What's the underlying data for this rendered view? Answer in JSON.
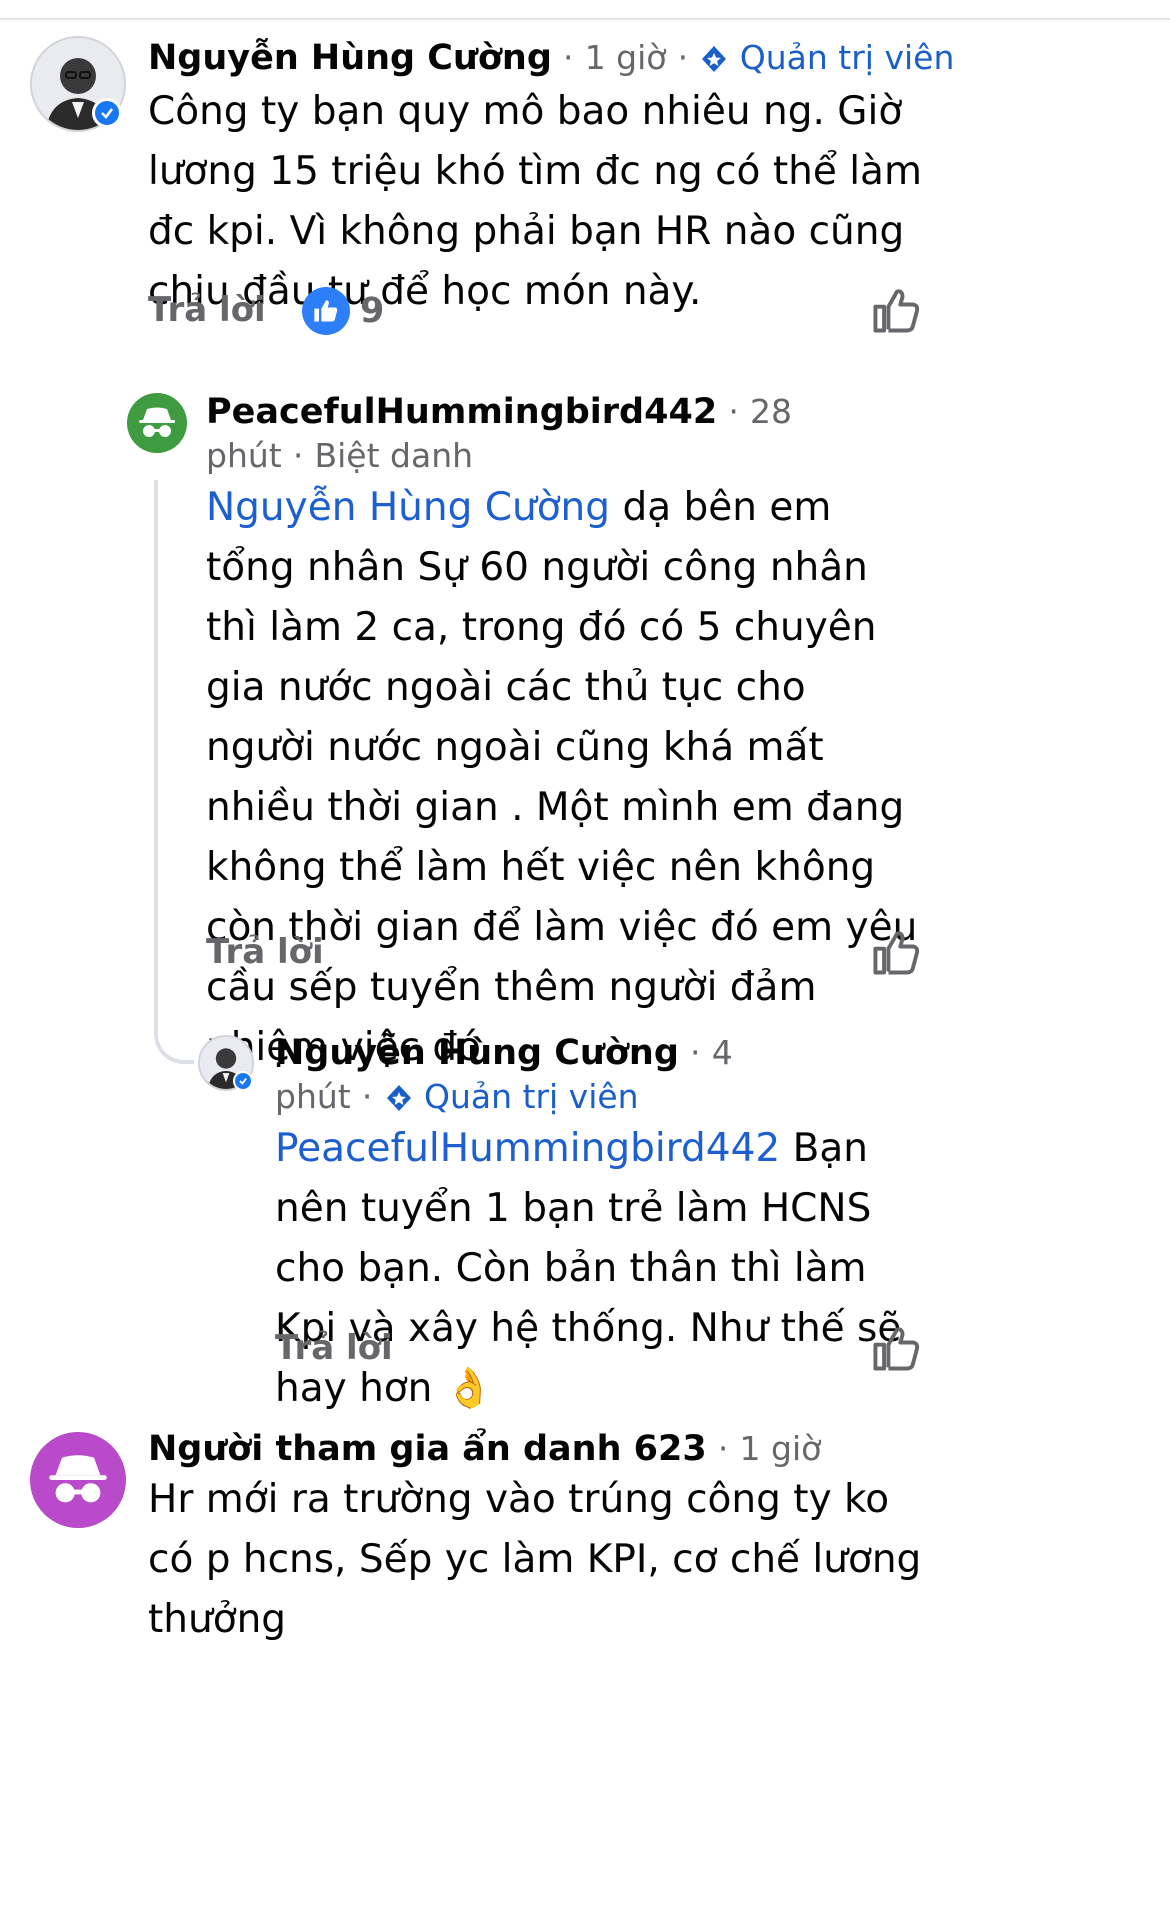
{
  "colors": {
    "mention": "#1d5fd0",
    "meta": "#65676b",
    "verified": "#1877f2",
    "like_badge": "#2d7ff9",
    "anon_green": "#3f9b3f",
    "anon_purple": "#b94ac9"
  },
  "comments": [
    {
      "author": "Nguyễn Hùng Cường",
      "time": "1 giờ",
      "role": "Quản trị viên",
      "text": "Công ty bạn quy mô bao nhiêu ng. Giờ lương 15 triệu khó tìm đc ng có thể làm đc kpi. Vì không phải bạn HR nào cũng chịu đầu tư để học món này.",
      "reply_label": "Trả lời",
      "reaction_count": "9",
      "reaction_icon": "thumbs-up-icon"
    },
    {
      "author": "PeacefulHummingbird442",
      "time_a": "28",
      "time_b": "phút",
      "role": "Biệt danh",
      "mention": "Nguyễn Hùng Cường",
      "text": " dạ bên em tổng nhân Sự 60 người công nhân thì làm 2 ca, trong đó có 5 chuyên gia nước ngoài các thủ tục cho người nước ngoài cũng khá mất nhiều thời gian . Một mình em đang không thể làm hết việc nên không còn thời gian để làm việc đó em yêu cầu sếp tuyển thêm người đảm nhiệm việc đó.",
      "reply_label": "Trả lời"
    },
    {
      "author": "Nguyễn Hùng Cường",
      "time_a": "4",
      "time_b": "phút",
      "role": "Quản trị viên",
      "mention": "PeacefulHummingbird442",
      "text": " Bạn nên tuyển 1 bạn trẻ làm HCNS cho bạn. Còn bản thân thì làm Kpi và xây hệ thống. Như thế sẽ hay hơn",
      "emoji": "👌",
      "reply_label": "Trả lời"
    },
    {
      "author": "Người tham gia ẩn danh 623",
      "time": "1 giờ",
      "text": "Hr mới ra trường vào trúng công ty ko có p hcns, Sếp yc làm KPI, cơ chế lương thưởng"
    }
  ],
  "separator": "·"
}
